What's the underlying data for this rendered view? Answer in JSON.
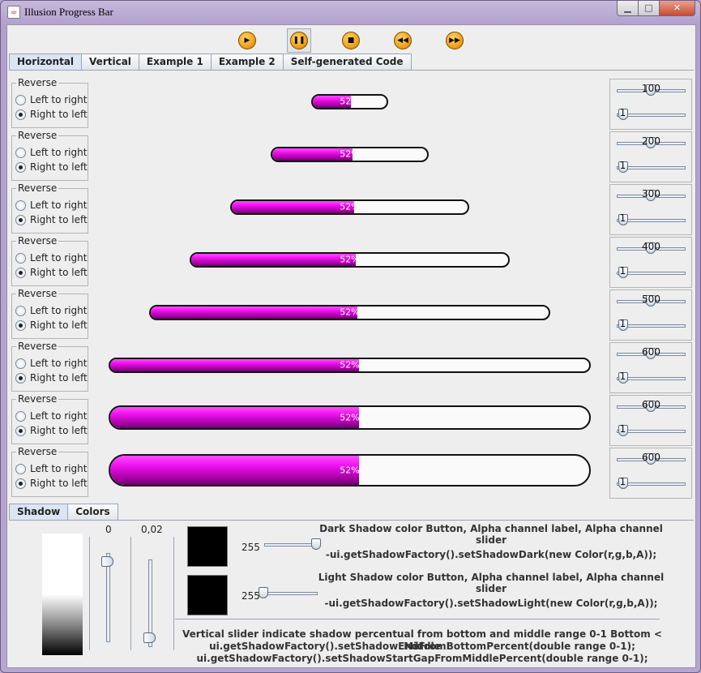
{
  "window": {
    "title": "Illusion Progress Bar"
  },
  "toolbar": {
    "buttons": [
      {
        "name": "play-icon",
        "glyph": "▶"
      },
      {
        "name": "pause-icon",
        "glyph": "❚❚"
      },
      {
        "name": "stop-icon",
        "glyph": "■"
      },
      {
        "name": "rewind-icon",
        "glyph": "◀◀"
      },
      {
        "name": "fast-forward-icon",
        "glyph": "▶▶"
      }
    ]
  },
  "tabs": [
    "Horizontal",
    "Vertical",
    "Example 1",
    "Example 2",
    "Self-generated Code"
  ],
  "active_tab": "Horizontal",
  "reverse": {
    "legend": "Reverse",
    "left_to_right": "Left to right",
    "right_to_left": "Right to left",
    "selected": "right_to_left"
  },
  "progress_text": "52%",
  "progress_value": 52,
  "rows": [
    {
      "width_value": "100",
      "thickness_value": "1"
    },
    {
      "width_value": "200",
      "thickness_value": "1"
    },
    {
      "width_value": "300",
      "thickness_value": "1"
    },
    {
      "width_value": "400",
      "thickness_value": "1"
    },
    {
      "width_value": "500",
      "thickness_value": "1"
    },
    {
      "width_value": "600",
      "thickness_value": "1"
    },
    {
      "width_value": "600",
      "thickness_value": "1"
    },
    {
      "width_value": "600",
      "thickness_value": "1"
    }
  ],
  "bottom_tabs": [
    "Shadow",
    "Colors"
  ],
  "bottom_active_tab": "Shadow",
  "shadow": {
    "end_from_bottom_label": "0",
    "start_gap_label": "0,02",
    "dark_alpha": "255",
    "light_alpha": "255",
    "dark_desc": "Dark Shadow color Button, Alpha channel label, Alpha channel slider",
    "dark_code": "-ui.getShadowFactory().setShadowDark(new Color(r,g,b,A));",
    "light_desc": "Light Shadow color Button, Alpha channel label, Alpha channel slider",
    "light_code": "-ui.getShadowFactory().setShadowLight(new Color(r,g,b,A));",
    "footer_line1": "Vertical slider indicate shadow percentual from bottom and middle range 0-1 Bottom < Middle",
    "footer_line2": "ui.getShadowFactory().setShadowEndFromBottomPercent(double range 0-1);",
    "footer_line3": "ui.getShadowFactory().setShadowStartGapFromMiddlePercent(double range 0-1);"
  },
  "colors": {
    "fill": "#ee10ee",
    "border": "#111111",
    "background": "#eeeeee"
  }
}
